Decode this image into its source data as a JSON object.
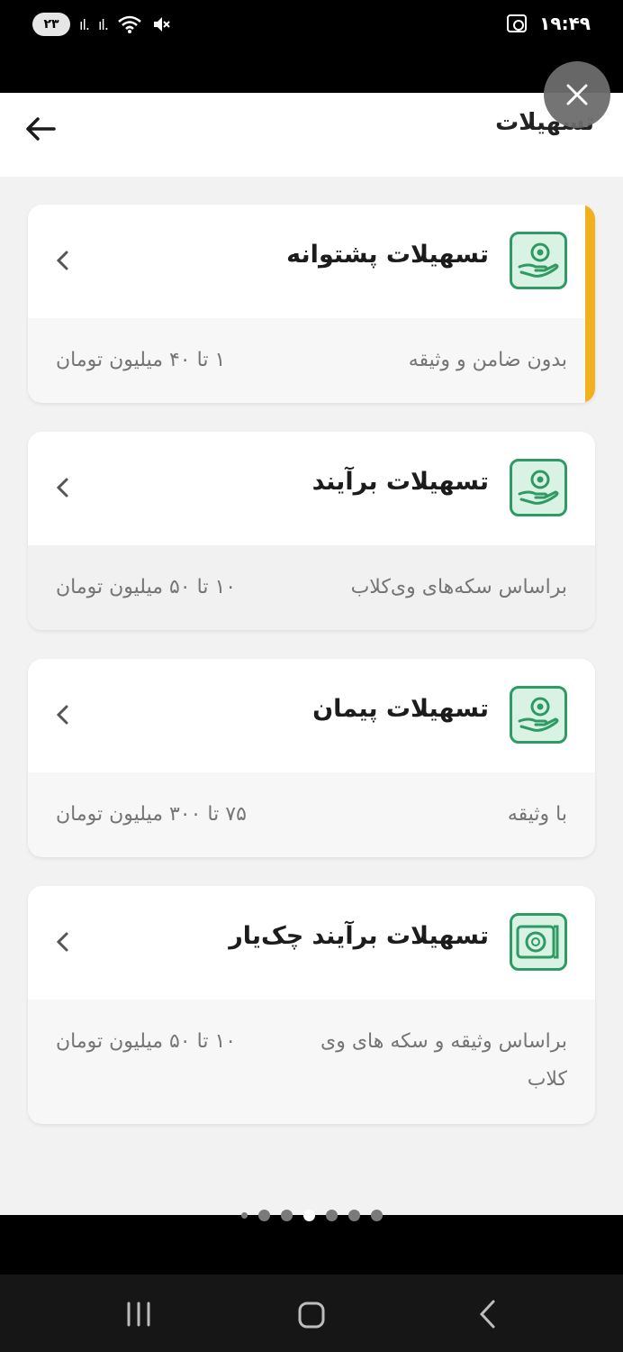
{
  "status_bar": {
    "time": "۱۹:۴۹",
    "battery": "۲۳",
    "signal_1": "ıl.",
    "signal_2": "ıl."
  },
  "header": {
    "title": "تسهیلات"
  },
  "cards": [
    {
      "title": "تسهیلات پشتوانه",
      "description": "بدون ضامن و وثیقه",
      "amount": "۱ تا ۴۰ میلیون تومان",
      "icon": "hand-coin-icon",
      "highlighted": true
    },
    {
      "title": "تسهیلات برآیند",
      "description": "براساس سکه‌های وی‌کلاب",
      "amount": "۱۰ تا ۵۰ میلیون تومان",
      "icon": "hand-coin-icon",
      "highlighted": false
    },
    {
      "title": "تسهیلات پیمان",
      "description": "با وثیقه",
      "amount": "۷۵ تا ۳۰۰ میلیون تومان",
      "icon": "hand-coin-icon",
      "highlighted": false
    },
    {
      "title": "تسهیلات برآیند چک‌یار",
      "description": "براساس وثیقه و سکه های وی کلاب",
      "amount": "۱۰ تا ۵۰ میلیون تومان",
      "icon": "cheque-icon",
      "highlighted": false
    }
  ],
  "colors": {
    "accent": "#f2b01e",
    "icon_green": "#2e9a64",
    "icon_bg": "#d9f2e3"
  }
}
